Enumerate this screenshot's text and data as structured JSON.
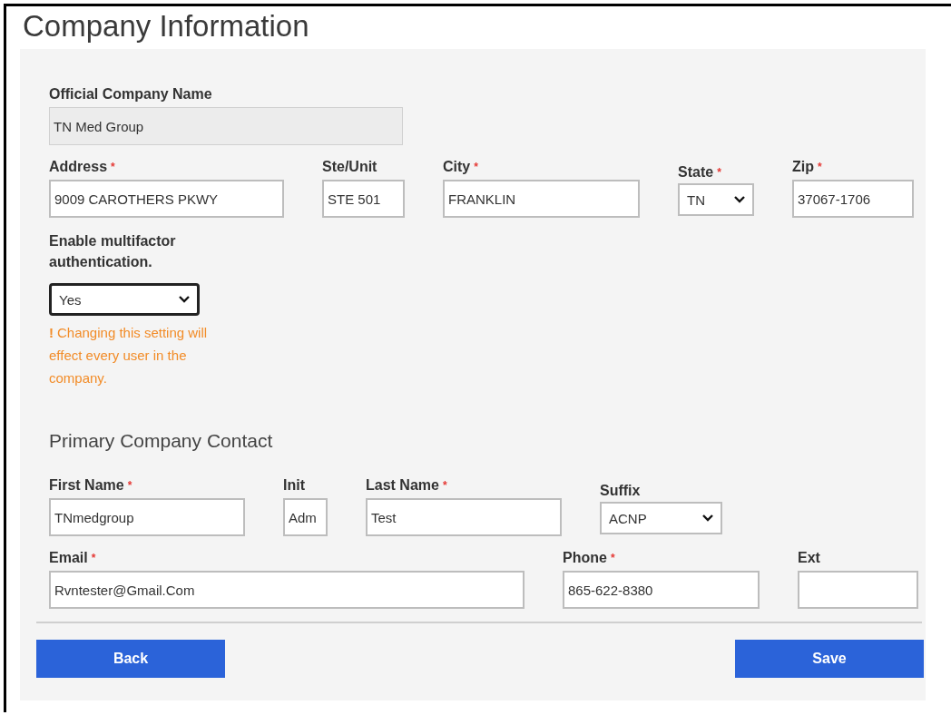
{
  "page_title": "Company Information",
  "company_rows": [
    [
      {
        "kind": "text",
        "label": "Official Company Name",
        "value": "TN Med Group",
        "disabled": true
      }
    ],
    [
      {
        "kind": "text",
        "label": "Address",
        "required_mark": "*",
        "value": "9009 CAROTHERS PKWY",
        "disabled": false
      },
      {
        "kind": "text",
        "label": "Ste/Unit",
        "value": "STE 501",
        "disabled": false
      },
      {
        "kind": "text",
        "label": "City",
        "required_mark": "*",
        "value": "FRANKLIN",
        "disabled": false
      },
      {
        "kind": "select",
        "label": "State",
        "required_mark": "*",
        "value": "TN",
        "disabled": false
      },
      {
        "kind": "text",
        "label": "Zip",
        "required_mark": "*",
        "value": "37067-1706",
        "disabled": false
      }
    ]
  ],
  "mfa": {
    "label": "Enable multifactor authentication.",
    "value": "Yes",
    "focused": true,
    "warning_icon": "!",
    "warning": "Changing this setting will effect every user in the company."
  },
  "contact_heading": "Primary Company Contact",
  "contact_rows": [
    [
      {
        "kind": "text",
        "label": "First Name",
        "required_mark": "*",
        "value": "TNmedgroup",
        "disabled": false
      },
      {
        "kind": "text",
        "label": "Init",
        "value": "Adm",
        "disabled": false
      },
      {
        "kind": "text",
        "label": "Last Name",
        "required_mark": "*",
        "value": "Test",
        "disabled": false
      },
      {
        "kind": "select",
        "label": "Suffix",
        "value": "ACNP",
        "disabled": false
      }
    ],
    [
      {
        "kind": "text",
        "label": "Email",
        "required_mark": "*",
        "value": "Rvntester@Gmail.Com",
        "disabled": false
      },
      {
        "kind": "text",
        "label": "Phone",
        "required_mark": "*",
        "value": "865-622-8380",
        "disabled": false
      },
      {
        "kind": "text",
        "label": "Ext",
        "disabled": false
      }
    ]
  ],
  "buttons": [
    {
      "label": "Back"
    },
    {
      "label": "Save"
    }
  ]
}
